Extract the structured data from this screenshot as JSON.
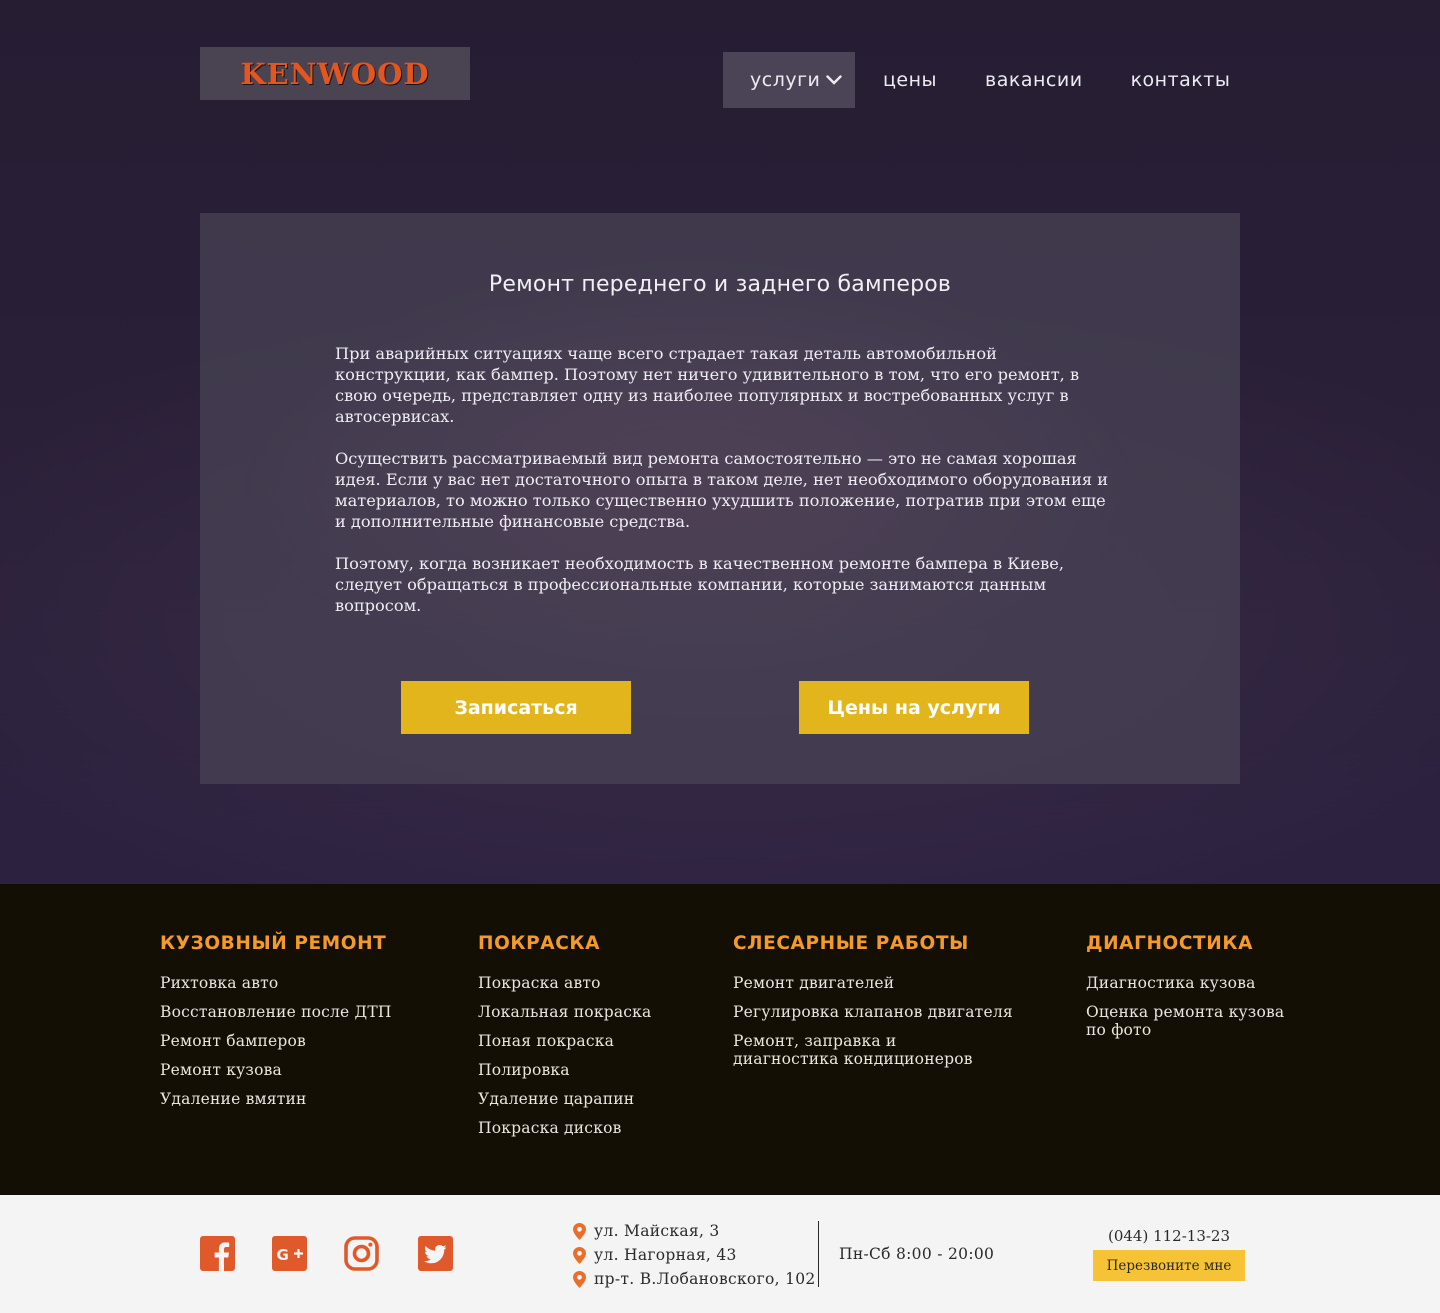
{
  "header": {
    "logo_text": "KENWOOD",
    "nav": [
      {
        "label": "услуги",
        "active": true
      },
      {
        "label": "цены"
      },
      {
        "label": "вакансии"
      },
      {
        "label": "контакты"
      }
    ]
  },
  "main": {
    "title": "Ремонт переднего и заднего бамперов",
    "paragraphs": [
      "При аварийных ситуациях чаще всего страдает такая деталь автомобильной конструкции, как бампер. Поэтому нет ничего удивительного в том, что его ремонт, в свою очередь, представляет одну из наиболее популярных и востребованных услуг в автосервисах.",
      "Осуществить рассматриваемый вид ремонта самостоятельно — это не самая хорошая идея. Если у вас нет достаточного опыта в таком деле, нет необходимого оборудования и материалов, то можно только существенно ухудшить положение, потратив при этом еще и дополнительные финансовые средства.",
      "Поэтому, когда возникает необходимость в качественном ремонте бампера в Киеве, следует обращаться в профессиональные компании, которые занимаются данным вопросом."
    ],
    "btn_book": "Записаться",
    "btn_prices": "Цены на услуги"
  },
  "services": [
    {
      "title": "КУЗОВНЫЙ РЕМОНТ",
      "items": [
        "Рихтовка авто",
        "Восстановление после ДТП",
        "Ремонт бамперов",
        "Ремонт кузова",
        "Удаление вмятин"
      ]
    },
    {
      "title": "ПОКРАСКА",
      "items": [
        "Покраска авто",
        "Локальная покраска",
        "Поная покраска",
        "Полировка",
        "Удаление царапин",
        "Покраска дисков"
      ]
    },
    {
      "title": "СЛЕСАРНЫЕ РАБОТЫ",
      "items": [
        "Ремонт двигателей",
        "Регулировка клапанов двигателя",
        "Ремонт, заправка и диагностика кондиционеров"
      ]
    },
    {
      "title": "ДИАГНОСТИКА",
      "items": [
        "Диагностика кузова",
        "Оценка ремонта кузова по фото"
      ]
    }
  ],
  "footer": {
    "social": [
      "facebook-icon",
      "google-plus-icon",
      "instagram-icon",
      "twitter-icon"
    ],
    "addresses": [
      "ул. Майская, 3",
      "ул. Нагорная, 43",
      "пр-т. В.Лобановского, 102"
    ],
    "hours": "Пн-Сб 8:00 - 20:00",
    "phone": "(044) 112-13-23",
    "callback": "Перезвоните мне"
  },
  "colors": {
    "accent_yellow": "#e1b51b",
    "accent_orange": "#f39a2c",
    "logo_orange": "#e4561f",
    "social_orange": "#e0592a",
    "pin_orange": "#e8702a",
    "hero_bg": "#2a2038",
    "footer_dark": "#140f05"
  }
}
